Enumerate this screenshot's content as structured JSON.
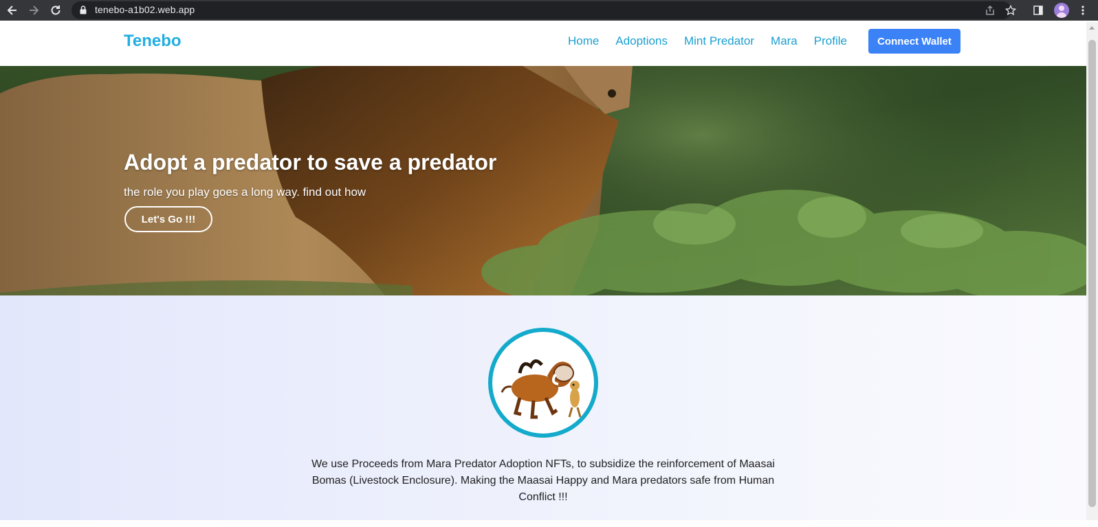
{
  "browser": {
    "url": "tenebo-a1b02.web.app",
    "icons": [
      "back-arrow-icon",
      "forward-arrow-icon",
      "reload-icon",
      "lock-icon",
      "share-icon",
      "star-icon",
      "sidebar-icon",
      "profile-avatar",
      "more-icon"
    ]
  },
  "nav": {
    "brand": "Tenebo",
    "links": [
      "Home",
      "Adoptions",
      "Mint Predator",
      "Mara",
      "Profile"
    ],
    "connect_label": "Connect Wallet",
    "accent_color": "#22aee0",
    "button_color": "#3b82f6"
  },
  "hero": {
    "title": "Adopt a predator to save a predator",
    "subtitle": "the role you play goes a long way. find out how",
    "cta_label": "Let's Go !!!"
  },
  "about": {
    "mission_text": "We use Proceeds from Mara Predator Adoption NFTs, to subsidize the reinforcement of Maasai Bomas (Livestock Enclosure). Making the Maasai Happy and Mara predators safe from Human Conflict !!!",
    "logo_border_color": "#13aacb"
  }
}
